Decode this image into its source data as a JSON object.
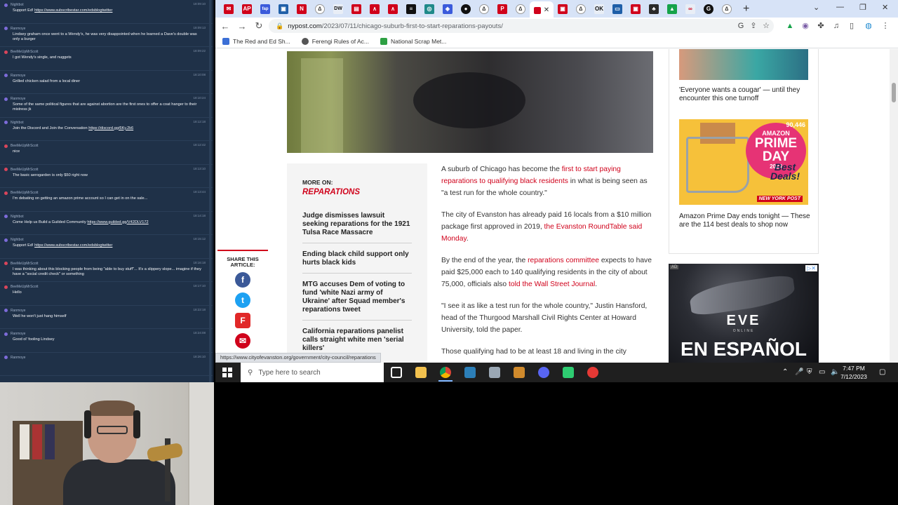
{
  "chat": {
    "messages": [
      {
        "user": "Nightbot",
        "time": "18:09:10",
        "text": "Support Ed!",
        "link": "https://www.subscribestar.com/edsblogtwitter",
        "color": "purple"
      },
      {
        "user": "Ranmoye",
        "time": "18:09:13",
        "text": "Lindsey graham once went to a Wendy's, he was very disappointed when he learned a Dave's double was only a burger",
        "link": "",
        "color": "purple"
      },
      {
        "user": "BeeMeUpMrScott",
        "time": "18:09:22",
        "text": "I got Wendy's single, and nuggets",
        "link": "",
        "color": "red"
      },
      {
        "user": "Ranmoye",
        "time": "18:10:08",
        "text": "Grilled chicken salad from a local diner",
        "link": "",
        "color": "purple"
      },
      {
        "user": "Ranmoye",
        "time": "18:10:24",
        "text": "Some of the same political figures that are against abortion are the first ones to offer a coat hanger to their mistress jk",
        "link": "",
        "color": "purple"
      },
      {
        "user": "Nightbot",
        "time": "18:12:18",
        "text": "Join the Discord and Join the Conversation",
        "link": "https://discord.gg/6Ky.2k6",
        "color": "purple"
      },
      {
        "user": "BeeMeUpMrScott",
        "time": "18:12:42",
        "text": "nice",
        "link": "",
        "color": "red"
      },
      {
        "user": "BeeMeUpMrScott",
        "time": "18:13:10",
        "text": "The basic aerogarden is only $50 right now",
        "link": "",
        "color": "red"
      },
      {
        "user": "BeeMeUpMrScott",
        "time": "18:13:44",
        "text": "I'm debating on getting an amazon prime account so I can get in on the sale...",
        "link": "",
        "color": "red"
      },
      {
        "user": "Nightbot",
        "time": "18:14:18",
        "text": "Come Help us Build a Guilded Community",
        "link": "https://www.guilded.gg/V42DLV172",
        "color": "purple"
      },
      {
        "user": "Nightbot",
        "time": "18:15:12",
        "text": "Support Ed!",
        "link": "https://www.subscribestar.com/edsblogtwitter",
        "color": "purple"
      },
      {
        "user": "BeeMeUpMrScott",
        "time": "18:16:18",
        "text": "I was thinking about this blocking people from being \"able to buy stuff\"... It's a slippery slope... imagine if they have a \"social credit check\" or something",
        "link": "",
        "color": "red"
      },
      {
        "user": "BeeMeUpMrScott",
        "time": "18:17:10",
        "text": "Hello",
        "link": "",
        "color": "red"
      },
      {
        "user": "Ranmoye",
        "time": "18:22:18",
        "text": "Well he won't just hang himself",
        "link": "",
        "color": "purple"
      },
      {
        "user": "Ranmoye",
        "time": "18:24:08",
        "text": "Good ol' fooling Lindsey",
        "link": "",
        "color": "purple"
      },
      {
        "user": "Ranmoye",
        "time": "18:26:10",
        "text": "",
        "link": "",
        "color": "purple"
      }
    ]
  },
  "browser": {
    "url_host": "nypost.com",
    "url_path": "/2023/07/11/chicago-suburb-first-to-start-reparations-payouts/",
    "tabs": [
      "AP",
      "fap",
      "N",
      "DW",
      "OK",
      "EVE"
    ],
    "bookmarks": [
      "The Red and Ed Sh...",
      "Ferengi Rules of Ac...",
      "National Scrap Met..."
    ],
    "status_url": "https://www.cityofevanston.org/government/city-council/reparations"
  },
  "page": {
    "more_on_label": "MORE ON:",
    "more_on_topic": "REPARATIONS",
    "related": [
      "Judge dismisses lawsuit seeking reparations for the 1921 Tulsa Race Massacre",
      "Ending black child support only hurts black kids",
      "MTG accuses Dem of voting to fund 'white Nazi army of Ukraine' after Squad member's reparations tweet",
      "California reparations panelist calls straight white men 'serial killers'"
    ],
    "share_label": "SHARE THIS ARTICLE:",
    "p1_a": "A suburb of Chicago has become the ",
    "p1_link": "first to start paying reparations to qualifying black residents",
    "p1_b": " in what is being seen as \"a test run for the whole country.\"",
    "p2_a": "The city of Evanston has already paid 16 locals from a $10 million package first approved in 2019, ",
    "p2_link": "the Evanston RoundTable said Monday",
    "p2_b": ".",
    "p3_a": "By the end of the year, the ",
    "p3_link1": "reparations committee",
    "p3_b": " expects to have paid $25,000 each to 140 qualifying residents in the city of about 75,000, officials also ",
    "p3_link2": "told the Wall Street Journal",
    "p3_c": ".",
    "p4": "\"I see it as like a test run for the whole country,\" Justin Hansford, head of the Thurgood Marshall Civil Rights Center at Howard University, told the paper.",
    "p5": "Those qualifying had to be at least 18 and living in the city"
  },
  "sidebar": {
    "story1": "'Everyone wants a cougar' — until they encounter this one turnoff",
    "promo_count": "90,446",
    "promo_line1": "AMAZON",
    "promo_line2": "PRIME DAY",
    "promo_year": "2023",
    "promo_deals": "Best Deals!",
    "promo_brand": "NEW YORK POST",
    "story2": "Amazon Prime Day ends tonight — These are the 114 best deals to shop now"
  },
  "ad": {
    "tag": "AD",
    "logo": "EVE",
    "sub": "ONLINE",
    "headline": "EN ESPAÑOL"
  },
  "taskbar": {
    "search_placeholder": "Type here to search",
    "time": "7:47 PM",
    "date": "7/12/2023"
  },
  "colors": {
    "accent_red": "#d0021b",
    "chat_bg": "#1f3148",
    "taskbar_bg": "#1f1f1f"
  }
}
